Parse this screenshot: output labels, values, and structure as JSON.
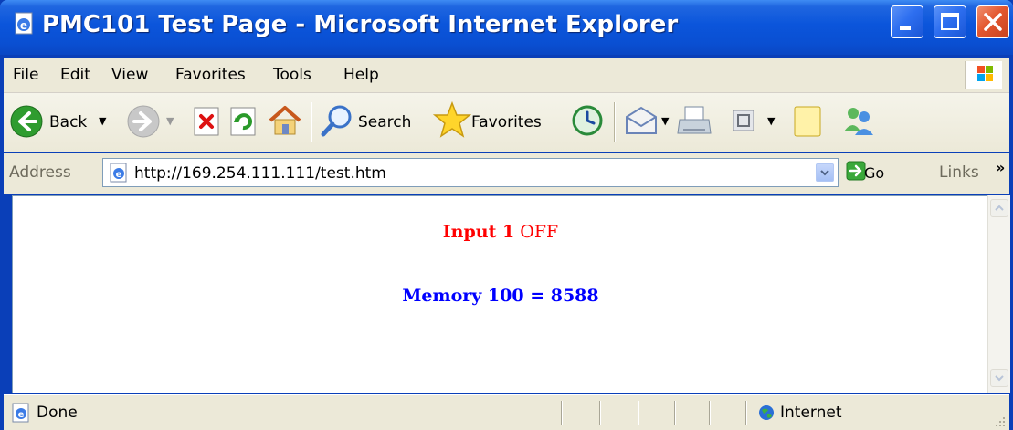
{
  "window": {
    "title": "PMC101 Test Page - Microsoft Internet Explorer"
  },
  "menu": {
    "items": [
      "File",
      "Edit",
      "View",
      "Favorites",
      "Tools",
      "Help"
    ]
  },
  "toolbar": {
    "back_label": "Back",
    "search_label": "Search",
    "favorites_label": "Favorites"
  },
  "address": {
    "label": "Address",
    "url": "http://169.254.111.111/test.htm",
    "go_label": "Go",
    "links_label": "Links",
    "links_chevron": "»"
  },
  "content": {
    "input_label": "Input 1",
    "input_state": "OFF",
    "memory_text": "Memory 100 = 8588",
    "input_color": "#ff0000",
    "memory_color": "#0000ff"
  },
  "status": {
    "text": "Done",
    "zone": "Internet"
  }
}
